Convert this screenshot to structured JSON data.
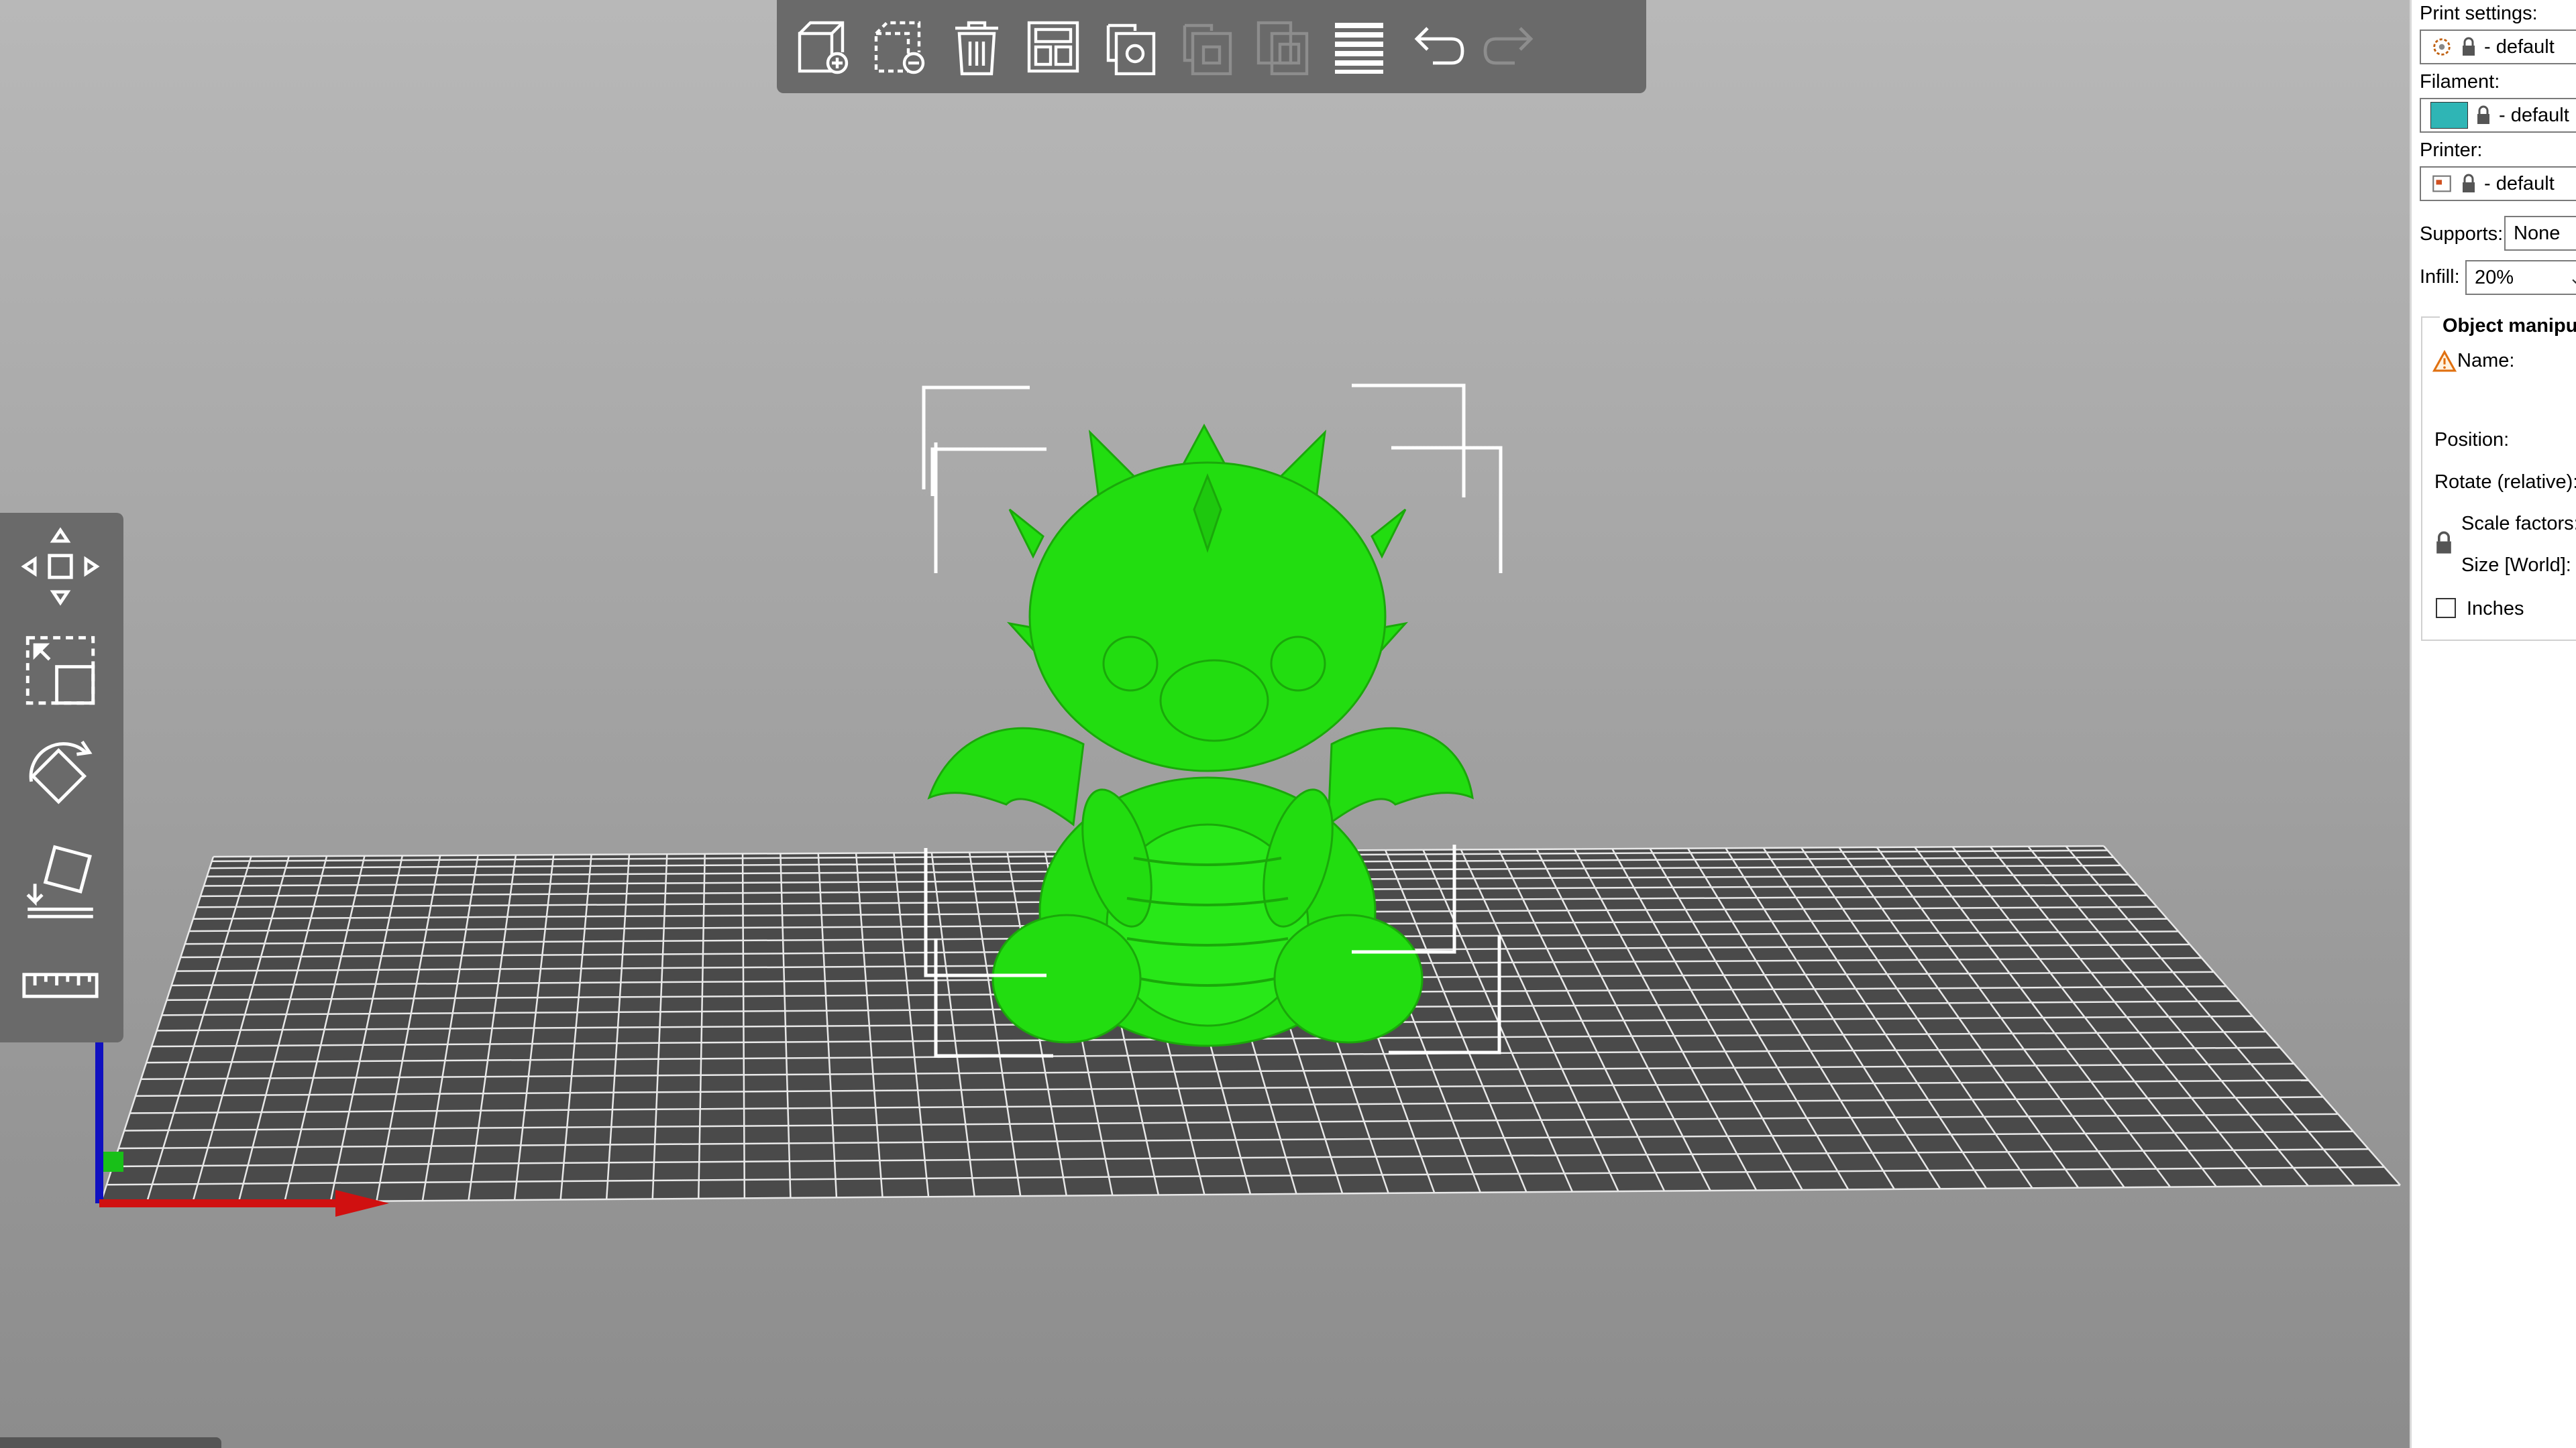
{
  "toolbar": {
    "buttons": [
      {
        "icon": "add-object-icon",
        "enabled": true
      },
      {
        "icon": "delete-object-icon",
        "enabled": true
      },
      {
        "icon": "delete-all-icon",
        "enabled": true
      },
      {
        "icon": "arrange-icon",
        "enabled": true
      },
      {
        "icon": "copy-icon",
        "enabled": true
      },
      {
        "icon": "paste-icon",
        "enabled": false
      },
      {
        "icon": "add-instance-icon",
        "enabled": false
      },
      {
        "icon": "layers-icon",
        "enabled": true
      },
      {
        "icon": "undo-icon",
        "enabled": true
      },
      {
        "icon": "redo-icon",
        "enabled": false
      }
    ]
  },
  "left_toolbar": {
    "tools": [
      "move-tool-icon",
      "scale-tool-icon",
      "rotate-tool-icon",
      "place-on-face-icon",
      "measure-tool-icon"
    ]
  },
  "sidebar": {
    "print_settings_label": "Print settings:",
    "print_settings_value": "- default",
    "filament_label": "Filament:",
    "filament_value": "- default",
    "filament_color": "#2fb5b5",
    "printer_label": "Printer:",
    "printer_value": "- default",
    "supports_label": "Supports:",
    "supports_value": "None",
    "infill_label": "Infill:",
    "infill_value": "20%",
    "object_manipulation_title": "Object manipulation",
    "name_label": "Name:",
    "position_label": "Position:",
    "rotate_label": "Rotate (relative):",
    "scale_label": "Scale factors:",
    "size_label": "Size [World]:",
    "inches_label": "Inches"
  },
  "colors": {
    "model": "#22dd10",
    "bed": "#4a4a4a",
    "grid": "#e8e8e8",
    "axis_x": "#d01010",
    "axis_y": "#18c018",
    "axis_z": "#1010c0"
  }
}
